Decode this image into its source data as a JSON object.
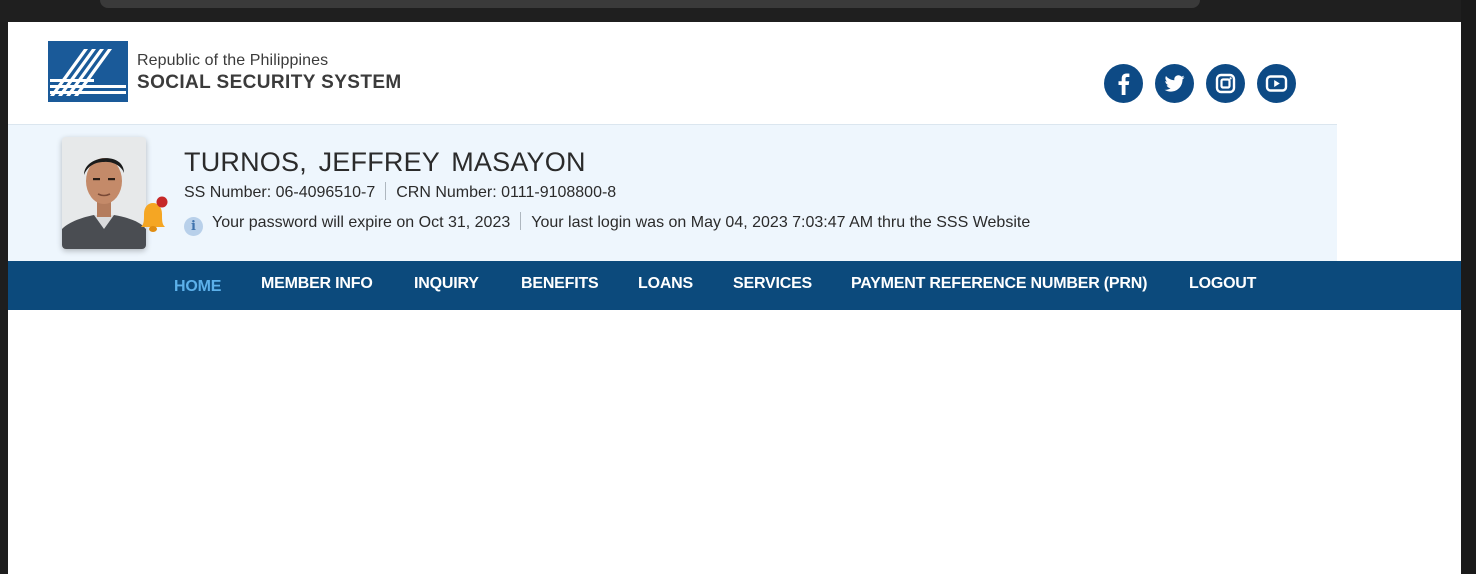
{
  "header": {
    "logo_line1": "Republic of the Philippines",
    "logo_line2": "SOCIAL SECURITY SYSTEM",
    "social": [
      {
        "name": "facebook-icon"
      },
      {
        "name": "twitter-icon"
      },
      {
        "name": "instagram-icon"
      },
      {
        "name": "youtube-icon"
      }
    ]
  },
  "member": {
    "name": "TURNOS, JEFFREY MASAYON",
    "ss_number": "SS Number: 06-4096510-7",
    "crn_number": "CRN Number: 0111-9108800-8",
    "password_notice": "Your password will expire on Oct 31, 2023",
    "last_login": "Your last login was on May 04, 2023 7:03:47 AM thru the SSS Website",
    "info_icon_glyph": "i"
  },
  "nav": {
    "items": [
      {
        "label": "HOME",
        "active": true
      },
      {
        "label": "MEMBER INFO"
      },
      {
        "label": "INQUIRY"
      },
      {
        "label": "BENEFITS"
      },
      {
        "label": "LOANS"
      },
      {
        "label": "SERVICES"
      },
      {
        "label": "PAYMENT REFERENCE NUMBER (PRN)"
      },
      {
        "label": "LOGOUT"
      }
    ]
  },
  "colors": {
    "brand_blue": "#0c4a7c",
    "active_nav": "#5cb0ea",
    "profile_bg": "#eef6fd",
    "notification": "#f5a623"
  }
}
